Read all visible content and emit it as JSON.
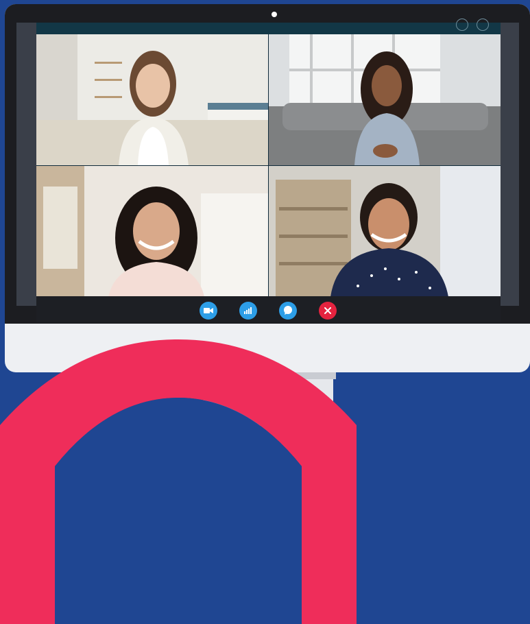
{
  "app": {
    "participants": [
      {
        "id": "participant-1",
        "hair": "#6b4a33",
        "top": "#f1efe8",
        "bg": "#e9e8e3"
      },
      {
        "id": "participant-2",
        "hair": "#2a1c16",
        "top": "#8fa1b8",
        "bg": "#d8dadb"
      },
      {
        "id": "participant-3",
        "hair": "#1c1411",
        "top": "#f4ddd6",
        "bg": "#e7e2dc"
      },
      {
        "id": "participant-4",
        "hair": "#241a15",
        "top": "#1e2a4d",
        "bg": "#d6d3cc"
      }
    ],
    "controls": [
      {
        "name": "video-button",
        "icon": "video-camera-icon",
        "color": "#2d9ee7"
      },
      {
        "name": "signal-button",
        "icon": "signal-bars-icon",
        "color": "#2d9ee7"
      },
      {
        "name": "chat-button",
        "icon": "chat-bubble-icon",
        "color": "#2d9ee7"
      },
      {
        "name": "end-call-button",
        "icon": "close-icon",
        "color": "#e5233f"
      }
    ]
  },
  "colors": {
    "background": "#1f4692",
    "accent_pink": "#ef2d5a",
    "bezel": "#1c1d21"
  }
}
